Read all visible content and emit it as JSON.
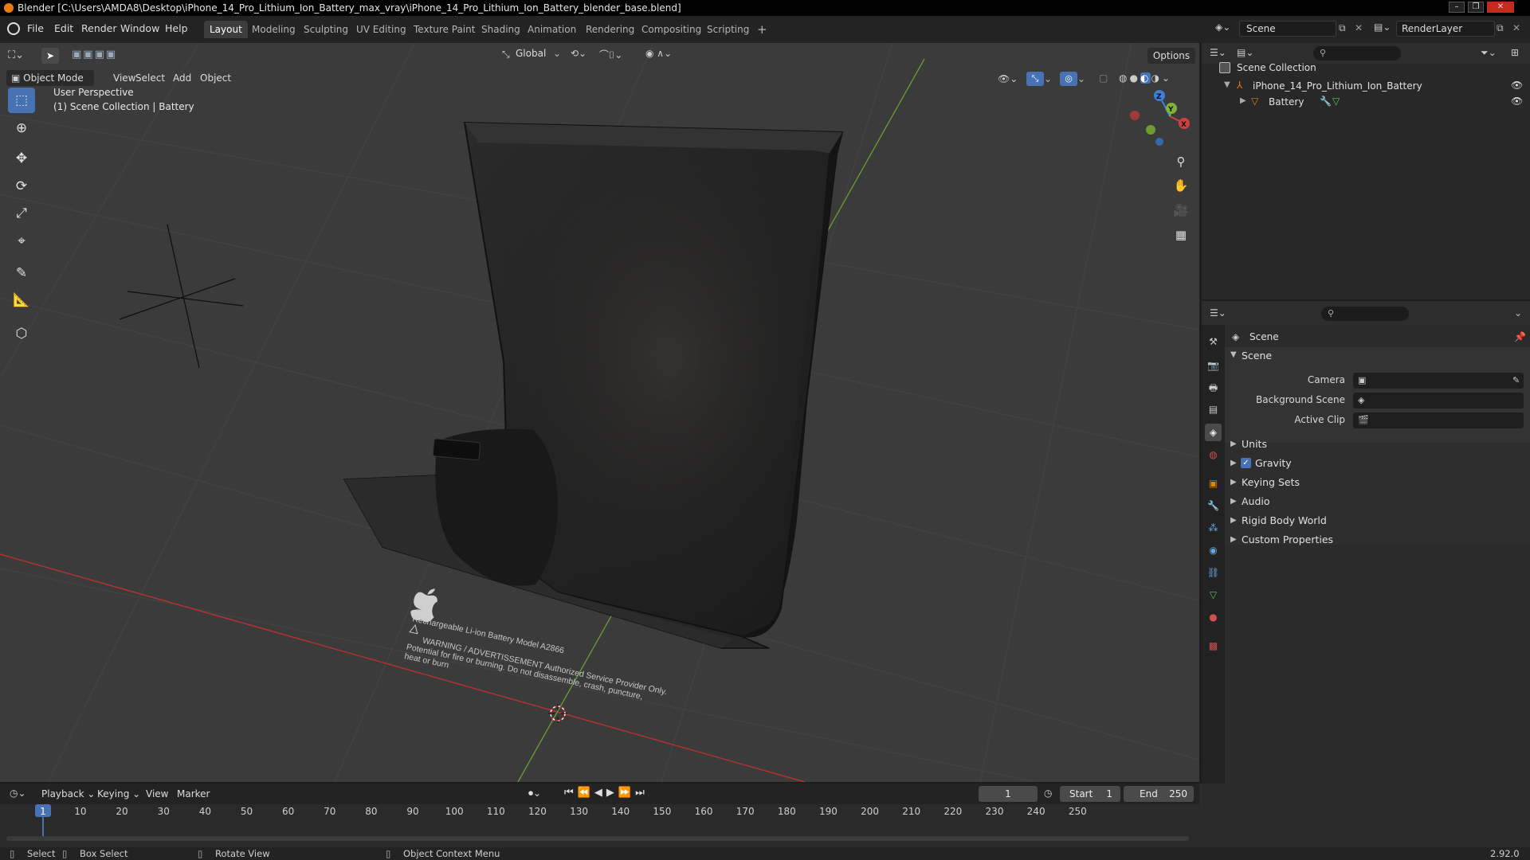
{
  "window": {
    "title": "Blender [C:\\Users\\AMDA8\\Desktop\\iPhone_14_Pro_Lithium_Ion_Battery_max_vray\\iPhone_14_Pro_Lithium_Ion_Battery_blender_base.blend]"
  },
  "menubar": {
    "menus": [
      "File",
      "Edit",
      "Render",
      "Window",
      "Help"
    ],
    "workspaces": [
      "Layout",
      "Modeling",
      "Sculpting",
      "UV Editing",
      "Texture Paint",
      "Shading",
      "Animation",
      "Rendering",
      "Compositing",
      "Scripting"
    ],
    "active_workspace": "Layout",
    "add_workspace": "+",
    "scene": "Scene",
    "view_layer": "RenderLayer"
  },
  "viewport_header": {
    "mode": "Object Mode",
    "menus": [
      "View",
      "Select",
      "Add",
      "Object"
    ],
    "orientation": "Global",
    "options": "Options"
  },
  "viewport": {
    "view_name": "User Perspective",
    "collection_info": "(1) Scene Collection | Battery",
    "gizmo_axes": [
      "X",
      "Y",
      "Z"
    ],
    "battery_label": {
      "line1": "Rechargeable Li-ion Battery Model A2866",
      "line2": "WARNING / ADVERTISSEMENT Authorized Service Provider Only.",
      "line3": "Potential for fire or burning. Do not disassemble, crash, puncture,",
      "line4": "heat or burn"
    }
  },
  "outliner": {
    "root": "Scene Collection",
    "items": [
      {
        "label": "iPhone_14_Pro_Lithium_Ion_Battery",
        "level": 1
      },
      {
        "label": "Battery",
        "level": 2
      }
    ]
  },
  "properties": {
    "context": "Scene",
    "section": "Scene",
    "fields": [
      {
        "label": "Camera",
        "value": ""
      },
      {
        "label": "Background Scene",
        "value": ""
      },
      {
        "label": "Active Clip",
        "value": ""
      }
    ],
    "panels": [
      "Units",
      "Gravity",
      "Keying Sets",
      "Audio",
      "Rigid Body World",
      "Custom Properties"
    ],
    "gravity_checked": true
  },
  "timeline": {
    "menus": [
      "Playback",
      "Keying",
      "View",
      "Marker"
    ],
    "current_frame": "1",
    "start_label": "Start",
    "start": "1",
    "end_label": "End",
    "end": "250",
    "ticks": [
      "1",
      "10",
      "20",
      "30",
      "40",
      "50",
      "60",
      "70",
      "80",
      "90",
      "100",
      "110",
      "120",
      "130",
      "140",
      "150",
      "160",
      "170",
      "180",
      "190",
      "200",
      "210",
      "220",
      "230",
      "240",
      "250"
    ]
  },
  "statusbar": {
    "select": "Select",
    "box_select": "Box Select",
    "rotate_view": "Rotate View",
    "context_menu": "Object Context Menu",
    "version": "2.92.0"
  },
  "colors": {
    "accent": "#4772b3",
    "orange": "#e87d0d",
    "x_axis": "#d04040",
    "y_axis": "#7fb33a",
    "z_axis": "#3d7fd6"
  }
}
